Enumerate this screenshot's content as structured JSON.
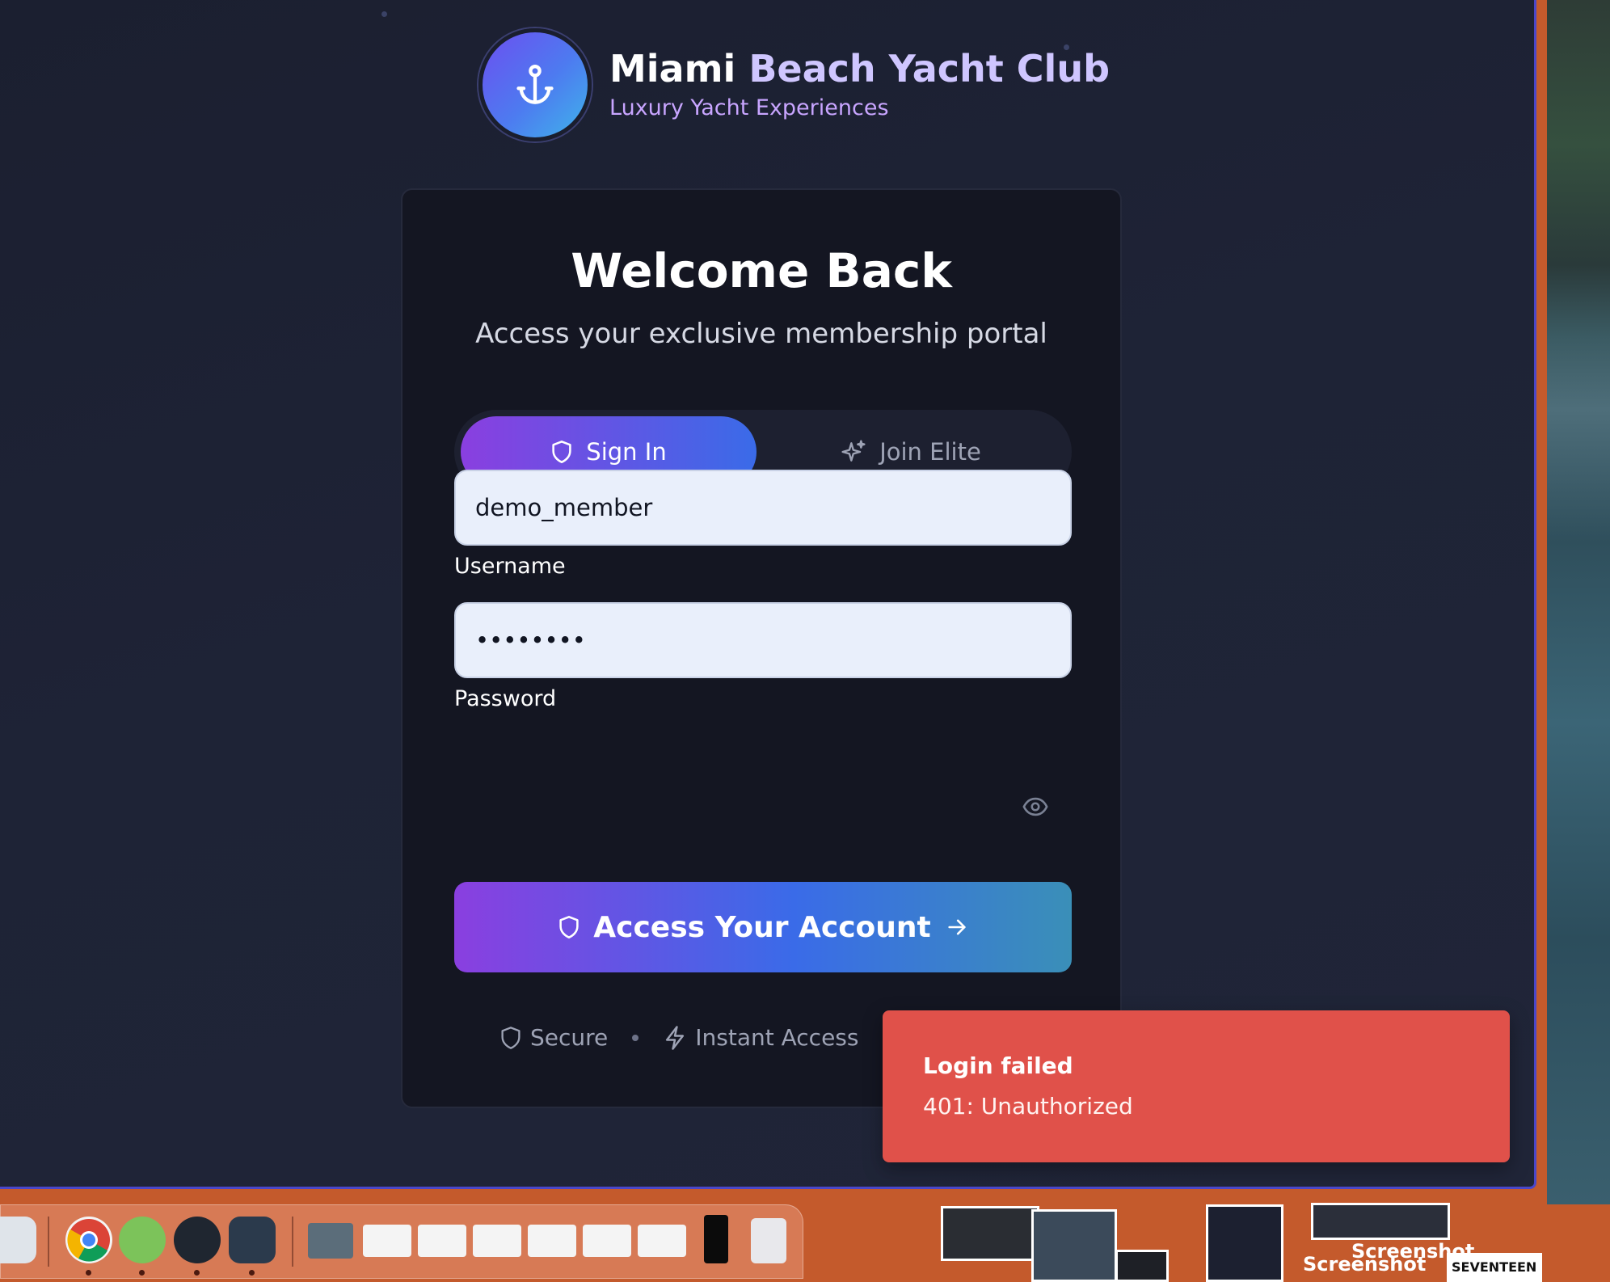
{
  "brand": {
    "title_part1": "Miami ",
    "title_part2": "Beach Yacht Club",
    "subtitle": "Luxury Yacht Experiences",
    "logo_icon": "anchor-icon"
  },
  "card": {
    "title": "Welcome Back",
    "subtitle": "Access your exclusive membership portal"
  },
  "tabs": [
    {
      "label": "Sign In",
      "icon": "shield-icon",
      "active": true
    },
    {
      "label": "Join Elite",
      "icon": "sparkles-icon",
      "active": false
    }
  ],
  "form": {
    "username_label": "Username",
    "username_value": "demo_member",
    "password_label": "Password",
    "password_value": "demopass",
    "submit_label": "Access Your Account"
  },
  "features": [
    {
      "label": "Secure",
      "icon": "shield-icon"
    },
    {
      "label": "Instant Access",
      "icon": "lightning-icon"
    }
  ],
  "toast": {
    "title": "Login failed",
    "message": "401: Unauthorized"
  },
  "desktop": {
    "labels": [
      "Screenshot",
      "Screenshot",
      "SEVENTEEN"
    ]
  },
  "colors": {
    "primary_gradient_start": "#8a3fe0",
    "primary_gradient_end": "#3a6be8",
    "toast_error": "#e0514a",
    "card_bg": "#141622"
  }
}
